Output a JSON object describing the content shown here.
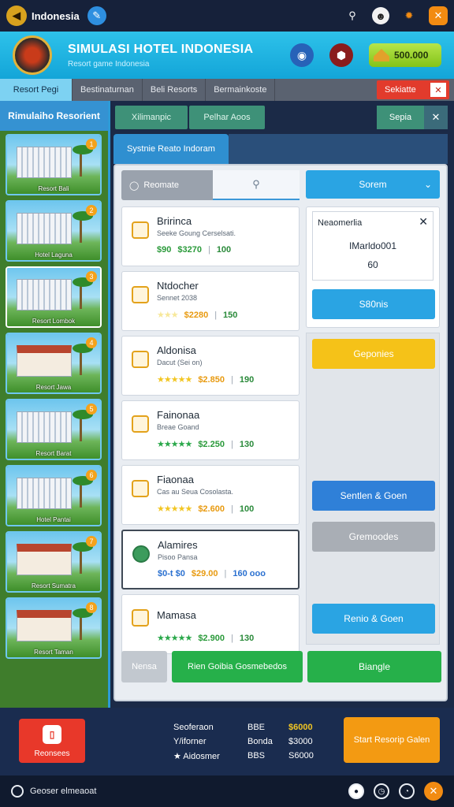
{
  "topbar": {
    "app_title": "Indonesia",
    "edit_icon": "pencil-icon",
    "icons": [
      "user-search-icon",
      "profile-icon",
      "settings-icon",
      "close-icon"
    ]
  },
  "header": {
    "title": "SIMULASI HOTEL INDONESIA",
    "subtitle": "Resort game Indonesia",
    "coins": "500.000"
  },
  "tabs": {
    "items": [
      "Resort Pegi",
      "Bestinaturnan",
      "Beli Resorts",
      "Bermainkoste"
    ],
    "active": 0,
    "right_label": "Sekiatte"
  },
  "sidebar": {
    "heading": "Rimulaiho Resorient",
    "hotels": [
      {
        "label": "Resort Bali",
        "badge": "1"
      },
      {
        "label": "Hotel Laguna",
        "badge": "2"
      },
      {
        "label": "Resort Lombok",
        "badge": "3"
      },
      {
        "label": "Resort Jawa",
        "badge": "4"
      },
      {
        "label": "Resort Barat",
        "badge": "5"
      },
      {
        "label": "Hotel Pantai",
        "badge": "6"
      },
      {
        "label": "Resort Sumatra",
        "badge": "7"
      },
      {
        "label": "Resort Taman",
        "badge": "8"
      }
    ]
  },
  "main": {
    "pill_1": "Xilimanpic",
    "pill_2": "Pelhar Aoos",
    "pill_right": "Sepia",
    "panel_tab": "Systnie Reato Indoram",
    "search_label": "Reomate",
    "sort_label": "Sorem",
    "listings": [
      {
        "name": "Bririnca",
        "sub": "Seeke Goung Cerselsati.",
        "stars": "",
        "price": "$90",
        "price2": "$3270",
        "count": "100",
        "style": "plain"
      },
      {
        "name": "Ntdocher",
        "sub": "Sennet 2038",
        "stars": "★★★",
        "price": "$2280",
        "count": "150",
        "style": "faint"
      },
      {
        "name": "Aldonisa",
        "sub": "Dacut (Sei on)",
        "stars": "★★★★★",
        "price": "$2.850",
        "count": "190",
        "style": "green"
      },
      {
        "name": "Fainonaa",
        "sub": "Breae Goand",
        "stars": "★★★★★",
        "price": "$2.250",
        "count": "130",
        "style": "green"
      },
      {
        "name": "Fiaonaa",
        "sub": "Cas au Seua Cosolasta.",
        "stars": "★★★★★",
        "price": "$2.600",
        "count": "100",
        "style": "faint"
      },
      {
        "name": "Alamires",
        "sub": "Pisoo Pansa",
        "stars": "",
        "price": "$0-t $0",
        "price2": "$29.00",
        "count": "160 ooo",
        "style": "blue"
      },
      {
        "name": "Mamasa",
        "sub": "",
        "stars": "★★★★★",
        "price": "$2.900",
        "count": "130",
        "style": "green"
      }
    ],
    "detail": {
      "title": "Neaomerlia",
      "value1": "IMarldo001",
      "value2": "60"
    },
    "actions": {
      "btn1": "S80nis",
      "btn2": "Geponies",
      "btn3": "Sentlen & Goen",
      "btn4": "Gremoodes",
      "btn5": "Renio & Goen"
    },
    "bottom": {
      "next": "Nensa",
      "book": "Rien Goibia Gosmebedos",
      "purchase": "Biangle"
    }
  },
  "footer": {
    "left_button": "Reonsees",
    "stats": [
      {
        "k": "Seoferaon",
        "m": "BBE",
        "v": "$6000",
        "hl": true
      },
      {
        "k": "Y/iforner",
        "m": "Bonda",
        "v": "$3000",
        "hl": false
      },
      {
        "k": "★ Aidosmer",
        "m": "BBS",
        "v": "S6000",
        "hl": false
      }
    ],
    "right_button": "Start Resorip Galen"
  },
  "bottombar": {
    "label": "Geoser elmeaoat"
  }
}
